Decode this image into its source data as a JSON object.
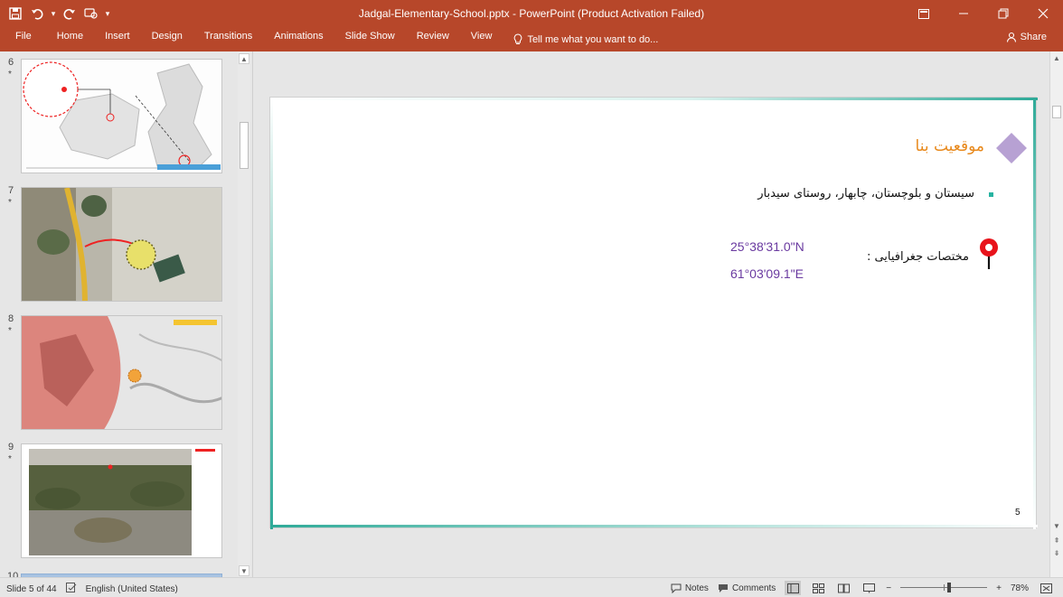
{
  "window": {
    "title": "Jadgal-Elementary-School.pptx - PowerPoint (Product Activation Failed)",
    "qat_icons": [
      "save-icon",
      "undo-icon",
      "redo-icon",
      "touch-mode-icon",
      "customize-qat-icon"
    ]
  },
  "ribbon": {
    "tabs": [
      "File",
      "Home",
      "Insert",
      "Design",
      "Transitions",
      "Animations",
      "Slide Show",
      "Review",
      "View"
    ],
    "tell_me": "Tell me what you want to do...",
    "share": "Share"
  },
  "thumbnails": [
    {
      "number": "6",
      "star": "*",
      "content": "map"
    },
    {
      "number": "7",
      "star": "*",
      "content": "satellite"
    },
    {
      "number": "8",
      "star": "*",
      "content": "terrain"
    },
    {
      "number": "9",
      "star": "*",
      "content": "aerial-photo"
    }
  ],
  "partial_thumbnail_number": "10",
  "slide": {
    "title": "موقعیت بنا",
    "bullet": "سیستان و بلوچستان، چابهار، روستای سیدبار",
    "geo_label": "مختصات جغرافیایی :",
    "latitude": "25°38'31.0\"N",
    "longitude": "61°03'09.1\"E",
    "number": "5",
    "colors": {
      "accent": "#2eaa98",
      "title": "#e8891c",
      "diamond": "#b7a1d3",
      "coord": "#6a3aa0",
      "pin": "#e8131b"
    }
  },
  "status": {
    "slide_of": "Slide 5 of 44",
    "language": "English (United States)",
    "notes": "Notes",
    "comments": "Comments",
    "zoom": "78%"
  }
}
